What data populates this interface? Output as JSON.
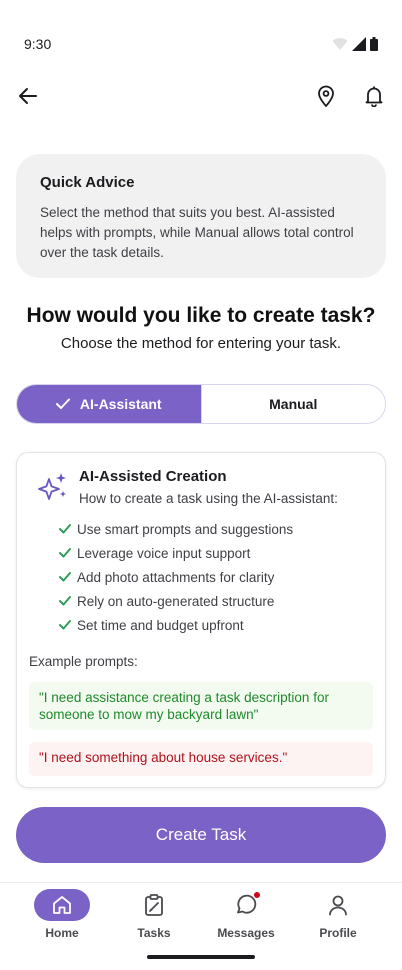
{
  "status_bar": {
    "time": "9:30"
  },
  "advice": {
    "title": "Quick Advice",
    "body": "Select the method that suits you best. AI-assisted helps with prompts, while Manual allows total control over the task details."
  },
  "question": {
    "title": "How would you like to create task?",
    "subtitle": "Choose the method for entering your task."
  },
  "modes": {
    "selected": "AI-Assistant",
    "options": [
      "AI-Assistant",
      "Manual"
    ]
  },
  "ai_card": {
    "title": "AI-Assisted Creation",
    "subtitle": "How to create a task using the AI-assistant:",
    "features": [
      "Use smart prompts and suggestions",
      "Leverage voice input support",
      "Add photo attachments for clarity",
      "Rely on auto-generated structure",
      "Set time and budget upfront"
    ],
    "examples_label": "Example prompts:",
    "good_prompt": "\"I need assistance creating a task description for someone to mow my backyard lawn\"",
    "bad_prompt": "\"I need something about house services.\""
  },
  "create_button": {
    "label": "Create Task"
  },
  "nav": {
    "items": [
      {
        "label": "Home",
        "icon": "home-icon",
        "active": true
      },
      {
        "label": "Tasks",
        "icon": "tasks-icon",
        "active": false
      },
      {
        "label": "Messages",
        "icon": "messages-icon",
        "active": false
      },
      {
        "label": "Profile",
        "icon": "profile-icon",
        "active": false
      }
    ]
  },
  "colors": {
    "accent": "#7b62c7",
    "good_text": "#1f8a2a",
    "good_bg": "#f3fbf1",
    "bad_text": "#b0121b",
    "bad_bg": "#fdf3f3",
    "check": "#2e9e5b",
    "badge": "#d0021b"
  }
}
